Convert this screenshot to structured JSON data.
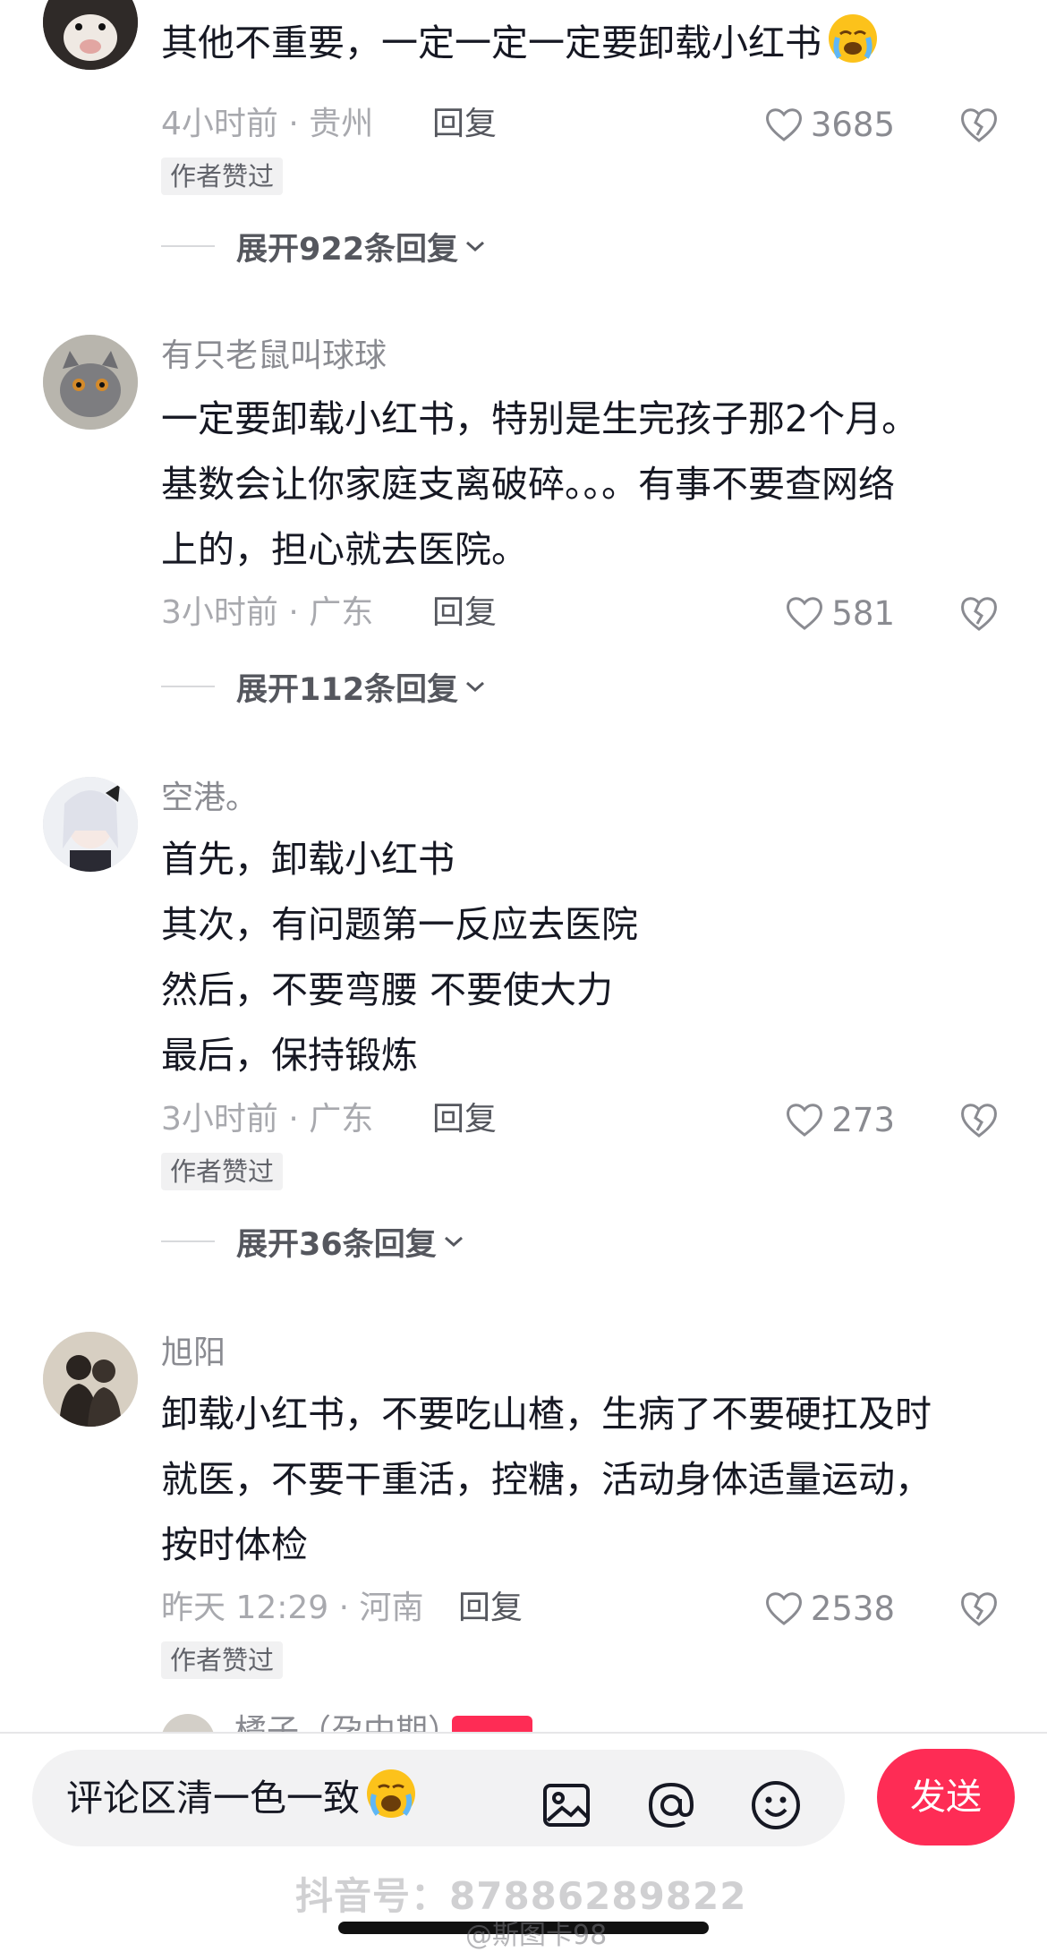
{
  "comments": [
    {
      "username": "",
      "lines": [
        "其他不重要，一定一定一定要卸载小红书"
      ],
      "has_emoji": true,
      "emoji_name": "loudly-crying-face",
      "time_location": "4小时前 · 贵州",
      "reply_label": "回复",
      "likes": "3685",
      "badge": "作者赞过",
      "expand_label": "展开922条回复"
    },
    {
      "username": "有只老鼠叫球球",
      "lines": [
        "一定要卸载小红书，特别是生完孩子那2个月。",
        "基数会让你家庭支离破碎。。。有事不要查网络",
        "上的，担心就去医院。"
      ],
      "time_location": "3小时前 · 广东",
      "reply_label": "回复",
      "likes": "581",
      "badge": "",
      "expand_label": "展开112条回复"
    },
    {
      "username": "空港。",
      "lines": [
        "首先，卸载小红书",
        "其次，有问题第一反应去医院",
        "然后，不要弯腰 不要使大力",
        "最后，保持锻炼"
      ],
      "time_location": "3小时前 · 广东",
      "reply_label": "回复",
      "likes": "273",
      "badge": "作者赞过",
      "expand_label": "展开36条回复"
    },
    {
      "username": "旭阳",
      "lines": [
        "卸载小红书，不要吃山楂，生病了不要硬扛及时",
        "就医，不要干重活，控糖，活动身体适量运动，",
        "按时体检"
      ],
      "time_location": "昨天 12:29 · 河南",
      "reply_label": "回复",
      "likes": "2538",
      "badge": "作者赞过",
      "expand_label": ""
    }
  ],
  "partial_comment": {
    "username": "橘子（孕中期）",
    "tag": "作者"
  },
  "composer": {
    "input_text": "评论区清一色一致",
    "input_emoji": "face-with-open-mouth-crying",
    "send_label": "发送",
    "icons": [
      "image-icon",
      "mention-icon",
      "emoji-icon"
    ]
  },
  "watermark": "抖音号：87886289822",
  "weibo_watermark": "@斯图卡98",
  "colors": {
    "accent": "#fe2c55",
    "text": "#161823",
    "meta": "#a8a9ae"
  }
}
